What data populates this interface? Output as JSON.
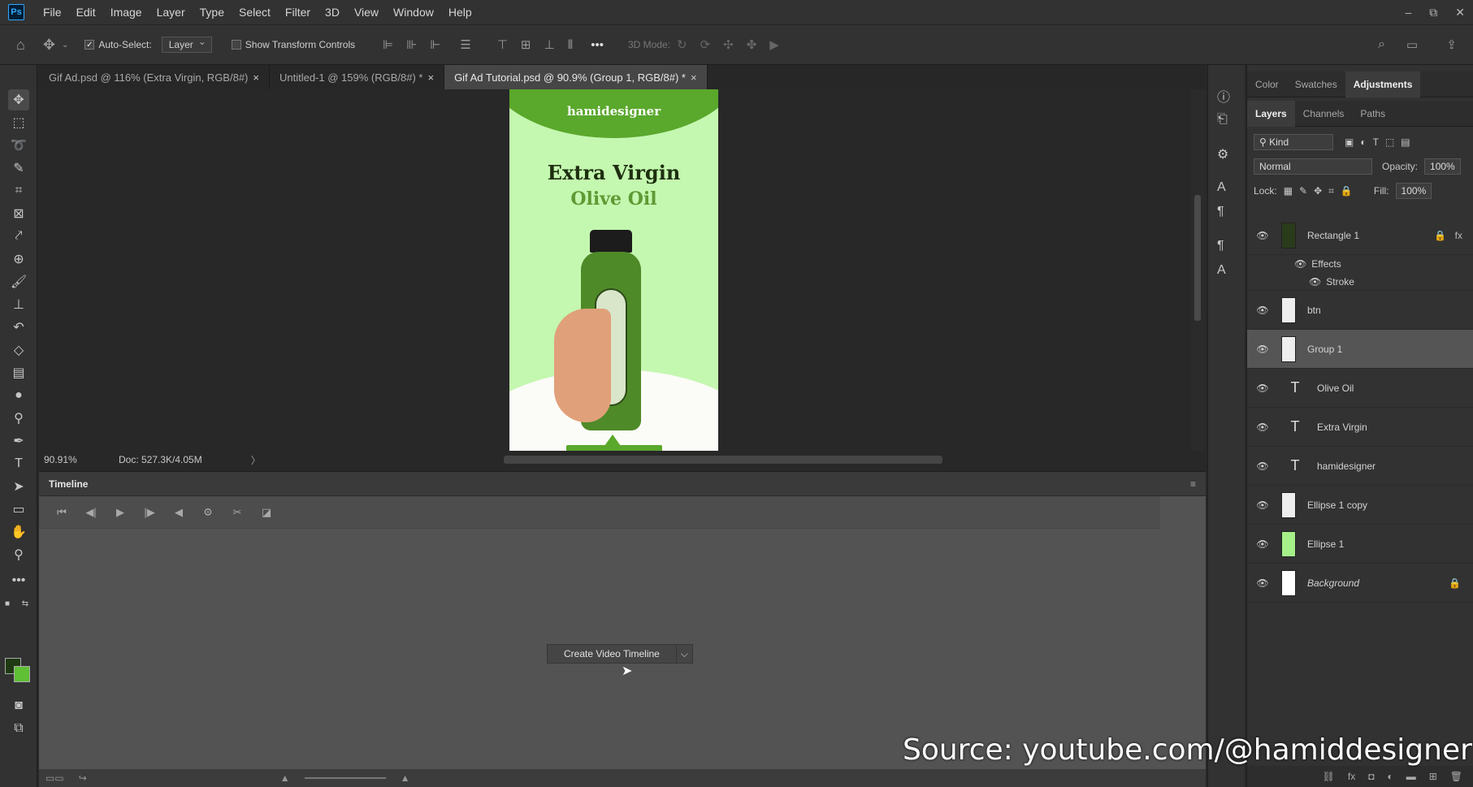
{
  "app": {
    "logo": "Ps"
  },
  "menu": [
    "File",
    "Edit",
    "Image",
    "Layer",
    "Type",
    "Select",
    "Filter",
    "3D",
    "View",
    "Window",
    "Help"
  ],
  "window_controls": {
    "minimize": "–",
    "restore": "⧉",
    "close": "✕"
  },
  "options": {
    "auto_select_label": "Auto-Select:",
    "auto_select_checked": true,
    "target_value": "Layer",
    "show_transform_label": "Show Transform Controls",
    "mode_3d_label": "3D Mode:",
    "more_icon": "•••"
  },
  "tabs": [
    {
      "label": "Gif Ad.psd @ 116% (Extra Virgin, RGB/8#)",
      "close": "×",
      "active": false
    },
    {
      "label": "Untitled-1 @ 159% (RGB/8#) *",
      "close": "×",
      "active": false
    },
    {
      "label": "Gif Ad Tutorial.psd @ 90.9% (Group 1, RGB/8#) *",
      "close": "×",
      "active": true
    }
  ],
  "canvas": {
    "brand": "hamidesigner",
    "headline": "Extra Virgin",
    "subheadline": "Olive Oil",
    "bottle_colors": {
      "background": "#c4f7b0",
      "accent": "#5aa82c",
      "dark": "#1d2f0e"
    }
  },
  "status": {
    "zoom": "90.91%",
    "doc": "Doc: 527.3K/4.05M",
    "arrow": "〉"
  },
  "timeline": {
    "title": "Timeline",
    "create_button": "Create Video Timeline",
    "dropdown_arrow": "⌵"
  },
  "right_panel": {
    "top_tabs": [
      "Color",
      "Swatches",
      "Adjustments"
    ],
    "active_top_tab": "Adjustments",
    "layer_tabs": [
      "Layers",
      "Channels",
      "Paths"
    ],
    "active_layer_tab": "Layers",
    "filter_kind": "Kind",
    "blend_mode": "Normal",
    "opacity_label": "Opacity:",
    "opacity_value": "100%",
    "lock_label": "Lock:",
    "fill_label": "Fill:",
    "fill_value": "100%"
  },
  "layers": [
    {
      "name": "Rectangle 1",
      "type": "shape",
      "thumb_color": "#2a3b1c",
      "locked": true,
      "fx": "fx",
      "selected": false
    },
    {
      "name": "btn",
      "type": "group",
      "thumb_color": "#e8e8e8",
      "selected": false
    },
    {
      "name": "Group 1",
      "type": "group",
      "thumb_color": "#e8e8e8",
      "selected": true
    },
    {
      "name": "Olive Oil",
      "type": "text",
      "selected": false
    },
    {
      "name": "Extra Virgin",
      "type": "text",
      "selected": false
    },
    {
      "name": "hamidesigner",
      "type": "text",
      "selected": false
    },
    {
      "name": "Ellipse 1 copy",
      "type": "shape",
      "thumb_color": "#e8e8e8",
      "selected": false
    },
    {
      "name": "Ellipse 1",
      "type": "shape",
      "thumb_color": "#a6f08a",
      "selected": false
    },
    {
      "name": "Background",
      "type": "bg",
      "thumb_color": "#ffffff",
      "locked": true,
      "selected": false
    }
  ],
  "effects": {
    "label": "Effects",
    "stroke": "Stroke"
  },
  "watermark": "Source: youtube.com/@hamiddesigner"
}
